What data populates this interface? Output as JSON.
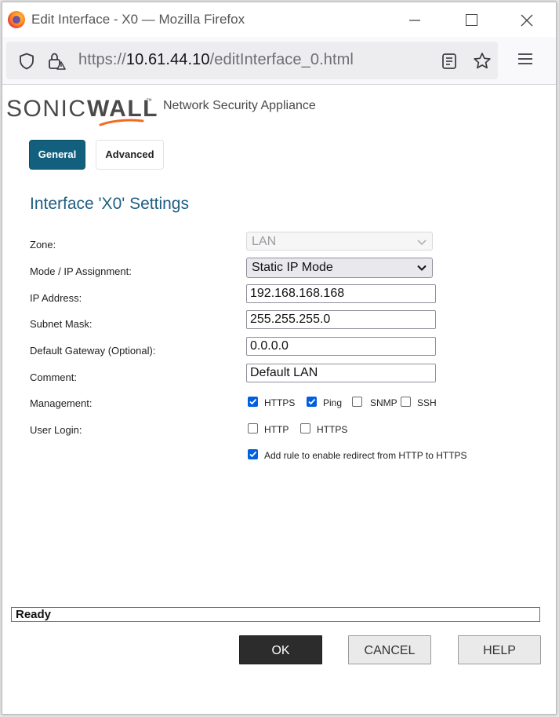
{
  "window": {
    "title": "Edit Interface - X0 — Mozilla Firefox",
    "url_prefix": "https://",
    "url_host": "10.61.44.10",
    "url_path": "/editInterface_0.html"
  },
  "brand": {
    "name_part1": "SONIC",
    "name_part2": "WALL",
    "trademark": "™",
    "tagline": "Network Security Appliance",
    "accent_color": "#f26a21"
  },
  "tabs": [
    {
      "label": "General",
      "active": true
    },
    {
      "label": "Advanced",
      "active": false
    }
  ],
  "form": {
    "title": "Interface 'X0' Settings",
    "zone": {
      "label": "Zone:",
      "value": "LAN",
      "disabled": true
    },
    "mode": {
      "label": "Mode / IP Assignment:",
      "value": "Static IP Mode"
    },
    "ip": {
      "label": "IP Address:",
      "value": "192.168.168.168"
    },
    "subnet": {
      "label": "Subnet Mask:",
      "value": "255.255.255.0"
    },
    "gateway": {
      "label": "Default Gateway (Optional):",
      "value": "0.0.0.0"
    },
    "comment": {
      "label": "Comment:",
      "value": "Default LAN"
    },
    "management": {
      "label": "Management:",
      "options": [
        {
          "label": "HTTPS",
          "checked": true
        },
        {
          "label": "Ping",
          "checked": true
        },
        {
          "label": "SNMP",
          "checked": false
        },
        {
          "label": "SSH",
          "checked": false
        }
      ]
    },
    "user_login": {
      "label": "User Login:",
      "options": [
        {
          "label": "HTTP",
          "checked": false
        },
        {
          "label": "HTTPS",
          "checked": false
        }
      ]
    },
    "redirect": {
      "label": "Add rule to enable redirect from HTTP to HTTPS",
      "checked": true
    }
  },
  "status": "Ready",
  "buttons": {
    "ok": "OK",
    "cancel": "CANCEL",
    "help": "HELP"
  },
  "colors": {
    "tab_active": "#12607d",
    "title_blue": "#1f5f82",
    "checkbox_blue": "#0060df",
    "ok_button": "#2c2c2c"
  }
}
